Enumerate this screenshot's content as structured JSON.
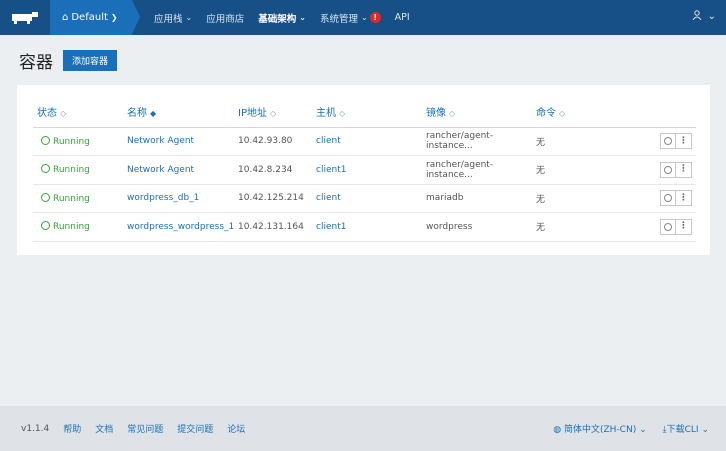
{
  "nav": {
    "environment": "Default",
    "items": [
      {
        "label": "应用栈",
        "chevron": true
      },
      {
        "label": "应用商店",
        "chevron": false
      },
      {
        "label": "基础架构",
        "chevron": true,
        "active": true
      },
      {
        "label": "系统管理",
        "chevron": true,
        "badge": "!"
      },
      {
        "label": "API",
        "chevron": false
      }
    ]
  },
  "header": {
    "title": "容器",
    "add_button": "添加容器"
  },
  "table": {
    "columns": [
      "状态",
      "名称",
      "IP地址",
      "主机",
      "镜像",
      "命令"
    ],
    "rows": [
      {
        "status": "Running",
        "name": "Network Agent",
        "ip": "10.42.93.80",
        "host": "client",
        "image": "rancher/agent-instance...",
        "command": "无"
      },
      {
        "status": "Running",
        "name": "Network Agent",
        "ip": "10.42.8.234",
        "host": "client1",
        "image": "rancher/agent-instance...",
        "command": "无"
      },
      {
        "status": "Running",
        "name": "wordpress_db_1",
        "ip": "10.42.125.214",
        "host": "client",
        "image": "mariadb",
        "command": "无"
      },
      {
        "status": "Running",
        "name": "wordpress_wordpress_1",
        "ip": "10.42.131.164",
        "host": "client1",
        "image": "wordpress",
        "command": "无"
      }
    ]
  },
  "footer": {
    "version": "v1.1.4",
    "links": [
      "帮助",
      "文档",
      "常见问题",
      "提交问题",
      "论坛"
    ],
    "language": "简体中文(ZH-CN)",
    "download": "下载CLI"
  }
}
